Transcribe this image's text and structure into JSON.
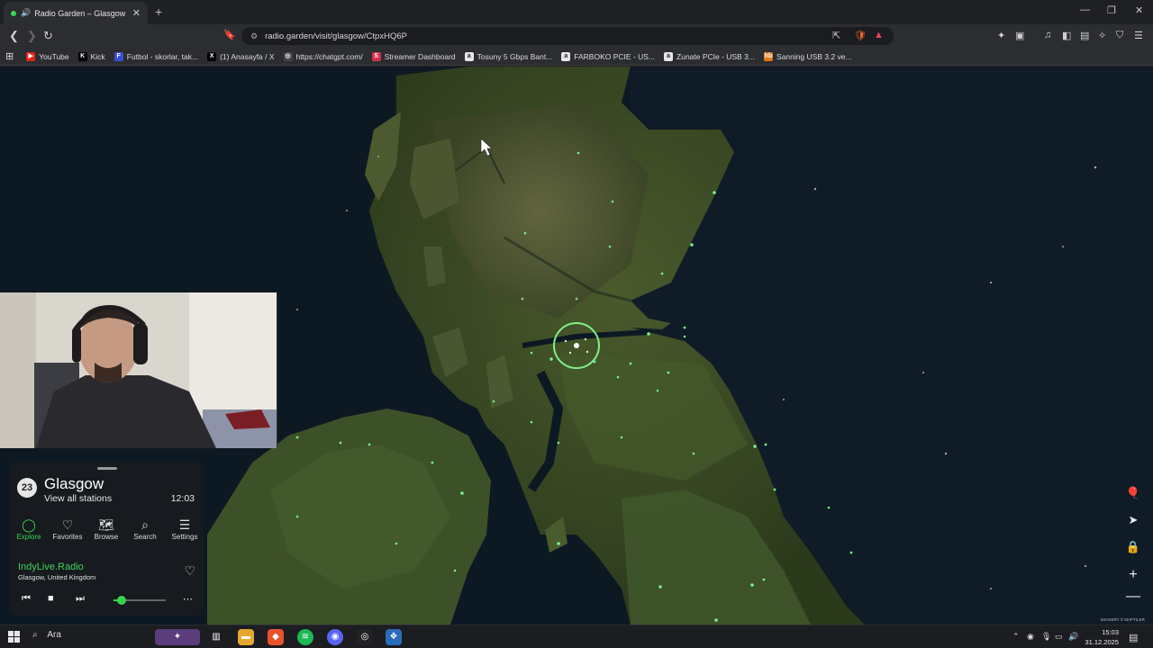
{
  "browser": {
    "tab_title": "Radio Garden – Glasgow",
    "url": "radio.garden/visit/glasgow/CtpxHQ6P",
    "bookmarks": [
      {
        "label": "YouTube",
        "color": "#e62117",
        "glyph": "▶"
      },
      {
        "label": "Kick",
        "color": "#000000",
        "glyph": "K"
      },
      {
        "label": "Futbol - skorlar, tak...",
        "color": "#3d4bd8",
        "glyph": "F"
      },
      {
        "label": "(1) Anasayfa / X",
        "color": "#000000",
        "glyph": "X"
      },
      {
        "label": "https://chatgpt.com/",
        "color": "#444444",
        "glyph": "◎"
      },
      {
        "label": "Streamer Dashboard",
        "color": "#d9304f",
        "glyph": "S"
      },
      {
        "label": "Tosuny 5 Gbps Bant...",
        "color": "#e6e6e6",
        "glyph": "a"
      },
      {
        "label": "FARBOKO PCIE - US...",
        "color": "#e6e6e6",
        "glyph": "a"
      },
      {
        "label": "Zunate PCIe - USB 3...",
        "color": "#e6e6e6",
        "glyph": "a"
      },
      {
        "label": "Sanning USB 3.2 ve...",
        "color": "#e0761a",
        "glyph": "hb"
      }
    ]
  },
  "radio": {
    "station_count": "23",
    "city": "Glasgow",
    "view_all": "View all stations",
    "local_time": "12:03",
    "nav": [
      {
        "label": "Explore",
        "icon": "explore-icon",
        "active": true
      },
      {
        "label": "Favorites",
        "icon": "heart-icon",
        "active": false
      },
      {
        "label": "Browse",
        "icon": "map-icon",
        "active": false
      },
      {
        "label": "Search",
        "icon": "search-icon",
        "active": false
      },
      {
        "label": "Settings",
        "icon": "menu-icon",
        "active": false
      }
    ],
    "now_playing": {
      "station": "IndyLive.Radio",
      "location": "Glasgow, United Kingdom"
    },
    "volume": 0.15,
    "accent": "#38d34f"
  },
  "map": {
    "attribution": "IMAGERY © MAPTILER"
  },
  "taskbar": {
    "search_placeholder": "Ara",
    "time": "15:03",
    "date": "31.12.2025"
  }
}
